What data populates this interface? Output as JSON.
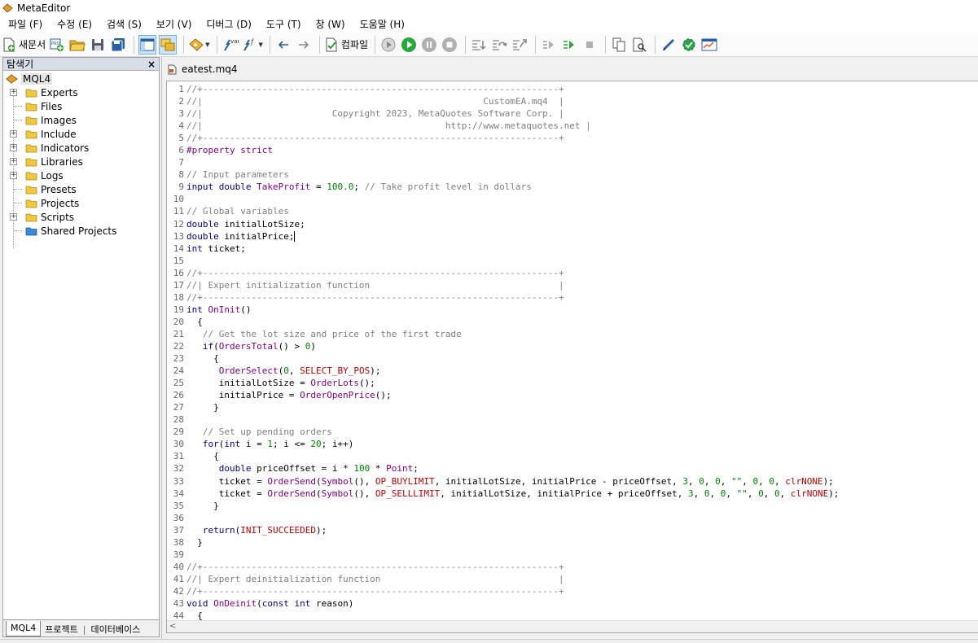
{
  "window": {
    "title": "MetaEditor"
  },
  "menu": [
    "파일 (F)",
    "수정 (E)",
    "검색 (S)",
    "보기 (V)",
    "디버그 (D)",
    "도구 (T)",
    "창 (W)",
    "도움말 (H)"
  ],
  "toolbar": {
    "new_label": "새문서",
    "compile_label": "컴파일",
    "var_label": "var"
  },
  "navigator": {
    "title": "탐색기",
    "close": "×",
    "root": "MQL4",
    "items": [
      {
        "label": "Experts",
        "expandable": true
      },
      {
        "label": "Files",
        "expandable": false
      },
      {
        "label": "Images",
        "expandable": false
      },
      {
        "label": "Include",
        "expandable": true
      },
      {
        "label": "Indicators",
        "expandable": true
      },
      {
        "label": "Libraries",
        "expandable": true
      },
      {
        "label": "Logs",
        "expandable": true
      },
      {
        "label": "Presets",
        "expandable": false
      },
      {
        "label": "Projects",
        "expandable": false
      },
      {
        "label": "Scripts",
        "expandable": true
      },
      {
        "label": "Shared Projects",
        "expandable": false
      }
    ],
    "tabs": [
      "MQL4",
      "프로젝트",
      "데이터베이스"
    ]
  },
  "editor": {
    "file_tab": "eatest.mq4",
    "lines": [
      "//+------------------------------------------------------------------+",
      "//|                                                    CustomEA.mq4  |",
      "//|                        Copyright 2023, MetaQuotes Software Corp. |",
      "//|                                             http://www.metaquotes.net |",
      "//+------------------------------------------------------------------+",
      "#property strict",
      "",
      "// Input parameters",
      "input double TakeProfit = 100.0; // Take profit level in dollars",
      "",
      "// Global variables",
      "double initialLotSize;",
      "double initialPrice;",
      "int ticket;",
      "",
      "//+------------------------------------------------------------------+",
      "//| Expert initialization function                                   |",
      "//+------------------------------------------------------------------+",
      "int OnInit()",
      "  {",
      "   // Get the lot size and price of the first trade",
      "   if(OrdersTotal() > 0)",
      "     {",
      "      OrderSelect(0, SELECT_BY_POS);",
      "      initialLotSize = OrderLots();",
      "      initialPrice = OrderOpenPrice();",
      "     }",
      "",
      "   // Set up pending orders",
      "   for(int i = 1; i <= 20; i++)",
      "     {",
      "      double priceOffset = i * 100 * Point;",
      "      ticket = OrderSend(Symbol(), OP_BUYLIMIT, initialLotSize, initialPrice - priceOffset, 3, 0, 0, \"\", 0, 0, clrNONE);",
      "      ticket = OrderSend(Symbol(), OP_SELLLIMIT, initialLotSize, initialPrice + priceOffset, 3, 0, 0, \"\", 0, 0, clrNONE);",
      "     }",
      "",
      "   return(INIT_SUCCEEDED);",
      "  }",
      "",
      "//+------------------------------------------------------------------+",
      "//| Expert deinitialization function                                 |",
      "//+------------------------------------------------------------------+",
      "void OnDeinit(const int reason)",
      "  {"
    ]
  }
}
